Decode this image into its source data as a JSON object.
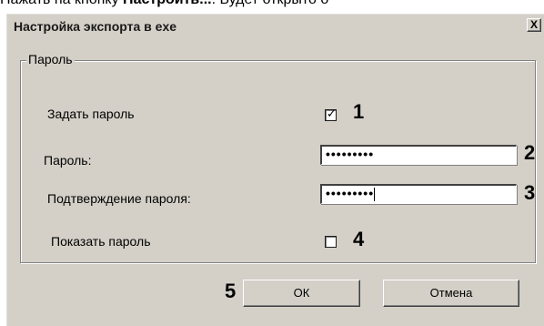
{
  "doc": {
    "prefix": "Нажать на кнопку ",
    "bold": "Настроить...",
    "suffix": ". Будет открыто о"
  },
  "dialog": {
    "title": "Настройка экспорта в exe",
    "close_label": "X"
  },
  "group": {
    "label": "Пароль"
  },
  "fields": {
    "set_password_label": "Задать пароль",
    "set_password_checked": true,
    "password_label": "Пароль:",
    "password_value": "•••••••••",
    "confirm_label": "Подтверждение пароля:",
    "confirm_value": "•••••••••",
    "show_password_label": "Показать пароль",
    "show_password_checked": false
  },
  "callouts": {
    "n1": "1",
    "n2": "2",
    "n3": "3",
    "n4": "4",
    "n5": "5"
  },
  "buttons": {
    "ok": "ОК",
    "cancel": "Отмена"
  },
  "glyphs": {
    "check": "✓"
  }
}
